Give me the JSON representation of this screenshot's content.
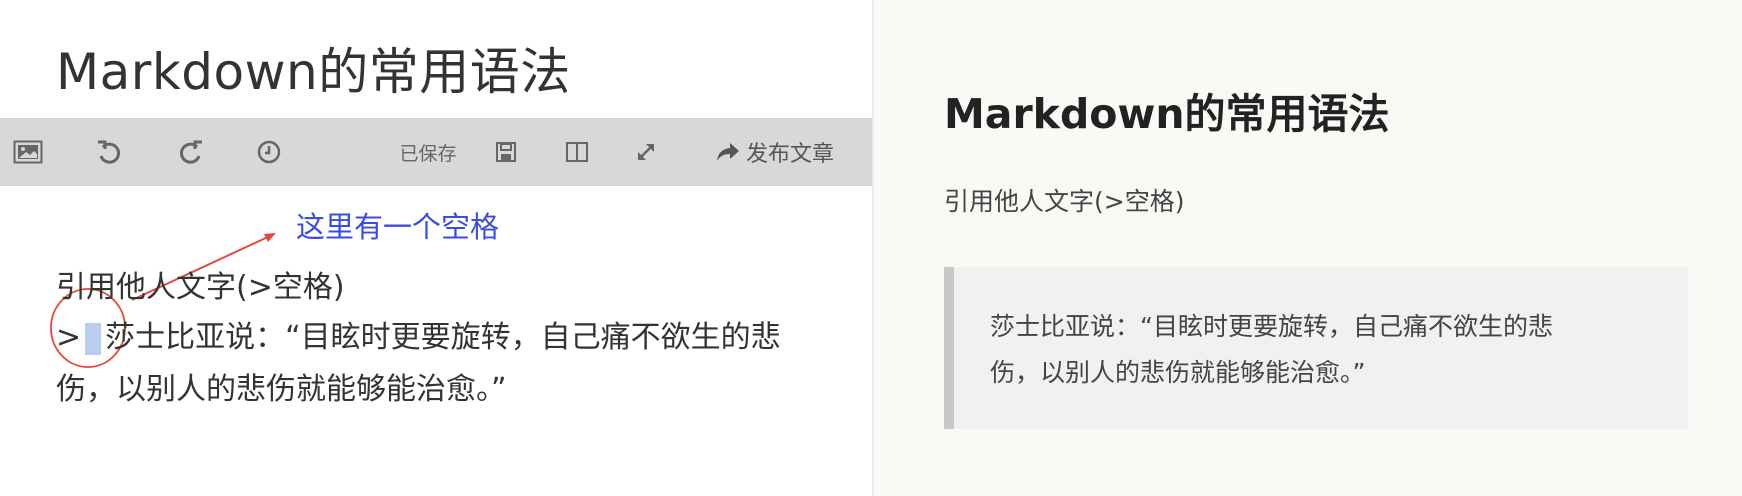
{
  "editor": {
    "title": "Markdown的常用语法",
    "toolbar": {
      "image_icon": "image-icon",
      "undo_icon": "undo-icon",
      "redo_icon": "redo-icon",
      "history_icon": "clock-icon",
      "saved_label": "已保存",
      "save_icon": "save-icon",
      "split_view_icon": "split-view-icon",
      "fullscreen_icon": "expand-icon",
      "publish_icon": "share-arrow-icon",
      "publish_label": "发布文章"
    },
    "annotation": "这里有一个空格",
    "lines": [
      "引用他人文字(>空格)",
      "莎士比亚说：“目眩时更要旋转，自己痛不欲生的悲",
      "伤，以别人的悲伤就能够能治愈。”"
    ],
    "quote_marker": ">"
  },
  "preview": {
    "title": "Markdown的常用语法",
    "paragraph": "引用他人文字(>空格)",
    "blockquote_lines": [
      "莎士比亚说：“目眩时更要旋转，自己痛不欲生的悲",
      "伤，以别人的悲伤就能够能治愈。”"
    ]
  },
  "colors": {
    "toolbar_bg": "#d8d8d8",
    "annotation": "#3a4de0",
    "arrow": "#e04a3c",
    "space_highlight": "#b9cdf0",
    "preview_bg": "#faf9f5"
  }
}
